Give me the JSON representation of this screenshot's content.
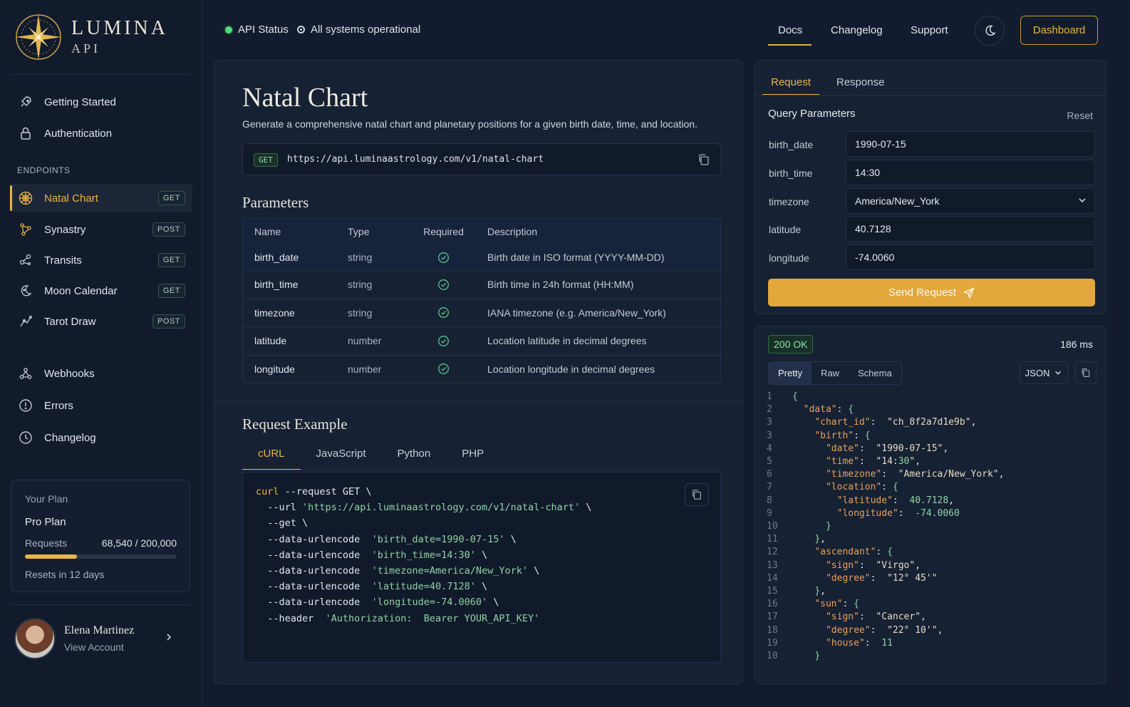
{
  "brand": {
    "name": "LUMINA",
    "sub": "API"
  },
  "sidebar": {
    "top_items": [
      {
        "label": "Getting Started",
        "icon": "rocket-icon"
      },
      {
        "label": "Authentication",
        "icon": "lock-icon"
      }
    ],
    "section_label": "ENDPOINTS",
    "endpoints": [
      {
        "label": "Natal Chart",
        "method": "GET",
        "icon": "zodiac-wheel-icon"
      },
      {
        "label": "Synastry",
        "method": "POST",
        "icon": "constellation-icon"
      },
      {
        "label": "Transits",
        "method": "GET",
        "icon": "orbit-icon"
      },
      {
        "label": "Moon Calendar",
        "method": "GET",
        "icon": "moon-icon"
      },
      {
        "label": "Tarot Draw",
        "method": "POST",
        "icon": "tarot-icon"
      }
    ],
    "bottom_items": [
      {
        "label": "Webhooks",
        "icon": "webhook-icon"
      },
      {
        "label": "Errors",
        "icon": "alert-circle-icon"
      },
      {
        "label": "Changelog",
        "icon": "clock-icon"
      }
    ],
    "plan": {
      "title": "Your Plan",
      "name": "Pro Plan",
      "requests_label": "Requests",
      "used": "68,540",
      "separator": "/",
      "limit": "200,000",
      "usage_fraction": 0.3427,
      "resets": "Resets in 12 days"
    },
    "user": {
      "name": "Elena Martinez",
      "sub": "View Account"
    }
  },
  "topbar": {
    "api_status": "API Status",
    "systems": "All systems operational",
    "nav": [
      "Docs",
      "Changelog",
      "Support"
    ],
    "dashboard": "Dashboard"
  },
  "main": {
    "title": "Natal Chart",
    "description": "Generate a comprehensive natal chart and planetary positions for a given birth date, time, and location.",
    "method": "GET",
    "url": "https://api.luminaastrology.com/v1/natal-chart",
    "params_heading": "Parameters",
    "params_columns": [
      "Name",
      "Type",
      "Required",
      "Description"
    ],
    "params": [
      {
        "name": "birth_date",
        "type": "string",
        "desc": "Birth date in ISO format (YYYY-MM-DD)"
      },
      {
        "name": "birth_time",
        "type": "string",
        "desc": "Birth time in 24h format (HH:MM)"
      },
      {
        "name": "timezone",
        "type": "string",
        "desc": "IANA timezone (e.g. America/New_York)"
      },
      {
        "name": "latitude",
        "type": "number",
        "desc": "Location latitude in decimal degrees"
      },
      {
        "name": "longitude",
        "type": "number",
        "desc": "Location longitude in decimal degrees"
      }
    ],
    "example_heading": "Request Example",
    "example_tabs": [
      "cURL",
      "JavaScript",
      "Python",
      "PHP"
    ],
    "code": {
      "l1_kw": "curl",
      "l1": " --request GET \\",
      "l2a": "  --url ",
      "l2s": "'https://api.luminaastrology.com/v1/natal-chart'",
      "l2b": " \\",
      "l3": "  --get \\",
      "lines": [
        {
          "a": "  --data-urlencode  ",
          "s": "'birth_date=1990-07-15'",
          "b": " \\"
        },
        {
          "a": "  --data-urlencode  ",
          "s": "'birth_time=14:30'",
          "b": " \\"
        },
        {
          "a": "  --data-urlencode  ",
          "s": "'timezone=America/New_York'",
          "b": " \\"
        },
        {
          "a": "  --data-urlencode  ",
          "s": "'latitude=40.7128'",
          "b": " \\"
        },
        {
          "a": "  --data-urlencode  ",
          "s": "'longitude=-74.0060'",
          "b": " \\"
        },
        {
          "a": "  --header  ",
          "s": "'Authorization:  Bearer YOUR_API_KEY'",
          "b": ""
        }
      ]
    }
  },
  "request": {
    "tabs": [
      "Request",
      "Response"
    ],
    "title": "Query Parameters",
    "reset": "Reset",
    "fields": [
      {
        "label": "birth_date",
        "value": "1990-07-15"
      },
      {
        "label": "birth_time",
        "value": "14:30"
      },
      {
        "label": "timezone",
        "value": "America/New_York"
      },
      {
        "label": "latitude",
        "value": "40.7128"
      },
      {
        "label": "longitude",
        "value": "-74.0060"
      }
    ],
    "send": "Send Request"
  },
  "response": {
    "status": "200 OK",
    "time": "186 ms",
    "views": [
      "Pretty",
      "Raw",
      "Schema"
    ],
    "format": "JSON",
    "lines": [
      {
        "n": "1",
        "t": "{"
      },
      {
        "n": "2",
        "t": "  \"data\": {"
      },
      {
        "n": "3",
        "t": "    \"chart_id\":  \"ch_8f2a7d1e9b\","
      },
      {
        "n": "3",
        "t": "    \"birth\": {"
      },
      {
        "n": "4",
        "t": "      \"date\":  \"1990-07-15\","
      },
      {
        "n": "5",
        "t": "      \"time\":  \"14:30\","
      },
      {
        "n": "6",
        "t": "      \"timezone\":  \"America/New_York\","
      },
      {
        "n": "7",
        "t": "      \"location\": {"
      },
      {
        "n": "8",
        "t": "        \"latitude\":  40.7128,"
      },
      {
        "n": "9",
        "t": "        \"longitude\":  -74.0060"
      },
      {
        "n": "10",
        "t": "      }"
      },
      {
        "n": "11",
        "t": "    },"
      },
      {
        "n": "12",
        "t": "    \"ascendant\": {"
      },
      {
        "n": "13",
        "t": "      \"sign\":  \"Virgo\","
      },
      {
        "n": "14",
        "t": "      \"degree\":  \"12° 45'\""
      },
      {
        "n": "15",
        "t": "    },"
      },
      {
        "n": "16",
        "t": "    \"sun\": {"
      },
      {
        "n": "17",
        "t": "      \"sign\":  \"Cancer\","
      },
      {
        "n": "18",
        "t": "      \"degree\":  \"22° 10'\","
      },
      {
        "n": "19",
        "t": "      \"house\":  11"
      },
      {
        "n": "10",
        "t": "    }"
      }
    ]
  },
  "colors": {
    "accent": "#e9b444",
    "success": "#4ade80",
    "background": "#121c2e"
  }
}
